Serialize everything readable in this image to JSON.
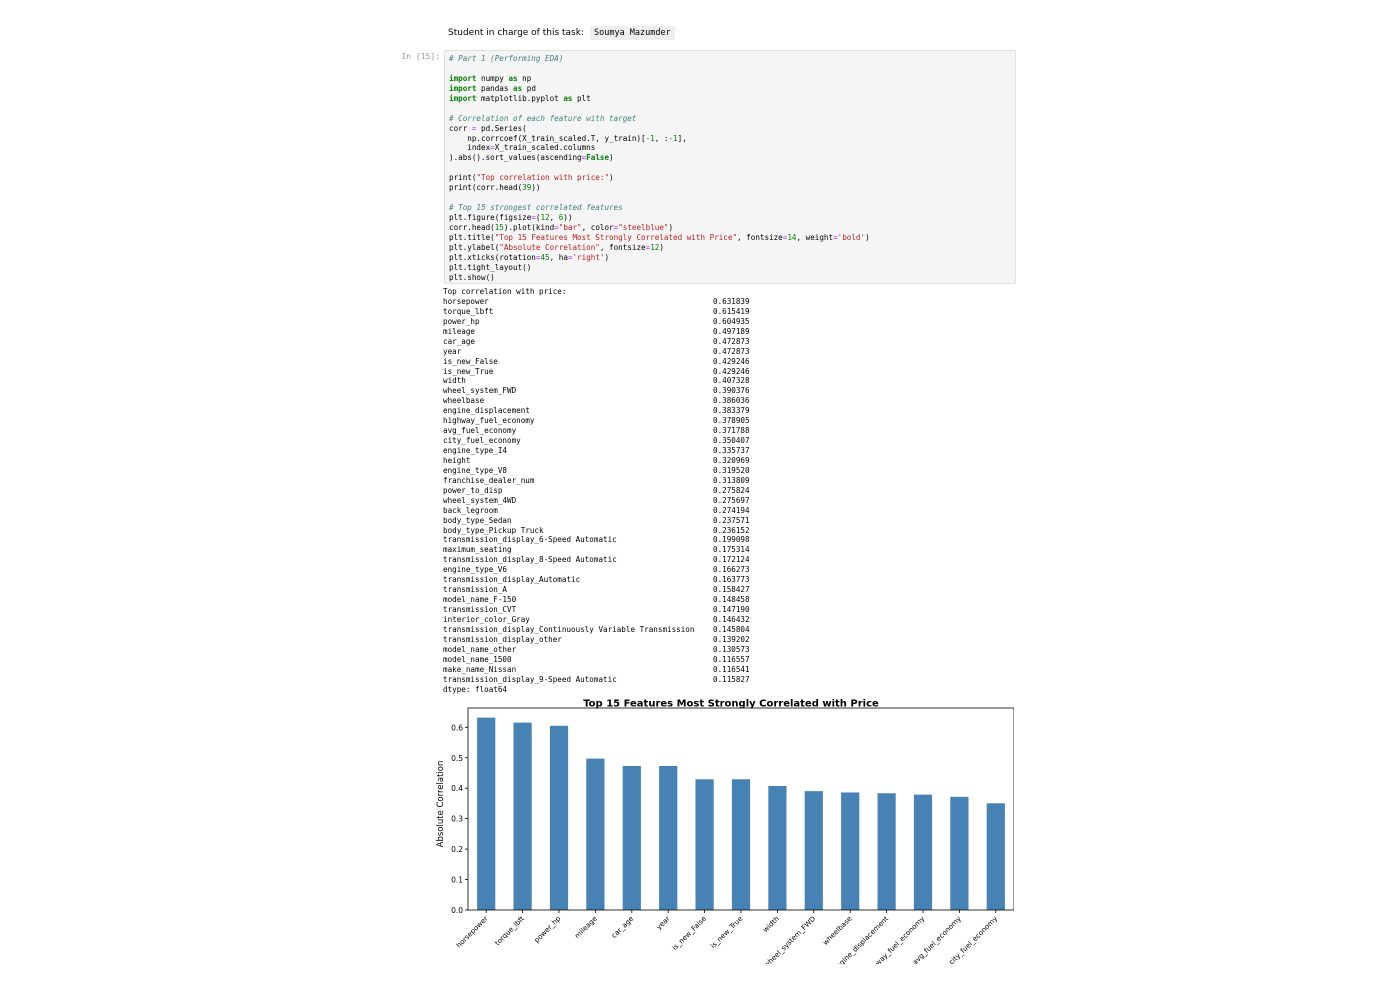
{
  "header": {
    "label": "Student in charge of this task:",
    "student": "Soumya Mazumder"
  },
  "cell": {
    "prompt": "In [15]:",
    "code_lines": [
      [
        {
          "t": "# Part 1 (Performing EDA)",
          "c": "c-cm"
        }
      ],
      [],
      [
        {
          "t": "import",
          "c": "c-kw"
        },
        {
          "t": " numpy "
        },
        {
          "t": "as",
          "c": "c-kw"
        },
        {
          "t": " np"
        }
      ],
      [
        {
          "t": "import",
          "c": "c-kw"
        },
        {
          "t": " pandas "
        },
        {
          "t": "as",
          "c": "c-kw"
        },
        {
          "t": " pd"
        }
      ],
      [
        {
          "t": "import",
          "c": "c-kw"
        },
        {
          "t": " matplotlib.pyplot "
        },
        {
          "t": "as",
          "c": "c-kw"
        },
        {
          "t": " plt"
        }
      ],
      [],
      [
        {
          "t": "# Correlation of each feature with target",
          "c": "c-cm"
        }
      ],
      [
        {
          "t": "corr "
        },
        {
          "t": "=",
          "c": "c-op"
        },
        {
          "t": " pd.Series("
        }
      ],
      [
        {
          "t": "    np.corrcoef(X_train_scaled.T, y_train)["
        },
        {
          "t": "-1",
          "c": "c-nm"
        },
        {
          "t": ", :"
        },
        {
          "t": "-1",
          "c": "c-nm"
        },
        {
          "t": "],"
        }
      ],
      [
        {
          "t": "    index"
        },
        {
          "t": "=",
          "c": "c-op"
        },
        {
          "t": "X_train_scaled.columns"
        }
      ],
      [
        {
          "t": ").abs().sort_values(ascending"
        },
        {
          "t": "=",
          "c": "c-op"
        },
        {
          "t": "False",
          "c": "c-kw"
        },
        {
          "t": ")"
        }
      ],
      [],
      [
        {
          "t": "print("
        },
        {
          "t": "\"Top correlation with price:\"",
          "c": "c-st"
        },
        {
          "t": ")"
        }
      ],
      [
        {
          "t": "print(corr.head("
        },
        {
          "t": "39",
          "c": "c-nm"
        },
        {
          "t": "))"
        }
      ],
      [],
      [
        {
          "t": "# Top 15 strongest correlated features",
          "c": "c-cm"
        }
      ],
      [
        {
          "t": "plt.figure(figsize"
        },
        {
          "t": "=",
          "c": "c-op"
        },
        {
          "t": "("
        },
        {
          "t": "12",
          "c": "c-nm"
        },
        {
          "t": ", "
        },
        {
          "t": "6",
          "c": "c-nm"
        },
        {
          "t": "))"
        }
      ],
      [
        {
          "t": "corr.head("
        },
        {
          "t": "15",
          "c": "c-nm"
        },
        {
          "t": ").plot(kind"
        },
        {
          "t": "=",
          "c": "c-op"
        },
        {
          "t": "\"bar\"",
          "c": "c-st"
        },
        {
          "t": ", color"
        },
        {
          "t": "=",
          "c": "c-op"
        },
        {
          "t": "\"steelblue\"",
          "c": "c-st"
        },
        {
          "t": ")"
        }
      ],
      [
        {
          "t": "plt.title("
        },
        {
          "t": "\"Top 15 Features Most Strongly Correlated with Price\"",
          "c": "c-st"
        },
        {
          "t": ", fontsize"
        },
        {
          "t": "=",
          "c": "c-op"
        },
        {
          "t": "14",
          "c": "c-nm"
        },
        {
          "t": ", weight"
        },
        {
          "t": "=",
          "c": "c-op"
        },
        {
          "t": "'bold'",
          "c": "c-st"
        },
        {
          "t": ")"
        }
      ],
      [
        {
          "t": "plt.ylabel("
        },
        {
          "t": "\"Absolute Correlation\"",
          "c": "c-st"
        },
        {
          "t": ", fontsize"
        },
        {
          "t": "=",
          "c": "c-op"
        },
        {
          "t": "12",
          "c": "c-nm"
        },
        {
          "t": ")"
        }
      ],
      [
        {
          "t": "plt.xticks(rotation"
        },
        {
          "t": "=",
          "c": "c-op"
        },
        {
          "t": "45",
          "c": "c-nm"
        },
        {
          "t": ", ha"
        },
        {
          "t": "=",
          "c": "c-op"
        },
        {
          "t": "'right'",
          "c": "c-st"
        },
        {
          "t": ")"
        }
      ],
      [
        {
          "t": "plt.tight_layout()"
        }
      ],
      [
        {
          "t": "plt.show()"
        }
      ]
    ]
  },
  "output": {
    "header": "Top correlation with price:",
    "rows": [
      [
        "horsepower",
        "0.631839"
      ],
      [
        "torque_lbft",
        "0.615419"
      ],
      [
        "power_hp",
        "0.604935"
      ],
      [
        "mileage",
        "0.497189"
      ],
      [
        "car_age",
        "0.472873"
      ],
      [
        "year",
        "0.472873"
      ],
      [
        "is_new_False",
        "0.429246"
      ],
      [
        "is_new_True",
        "0.429246"
      ],
      [
        "width",
        "0.407328"
      ],
      [
        "wheel_system_FWD",
        "0.390376"
      ],
      [
        "wheelbase",
        "0.386036"
      ],
      [
        "engine_displacement",
        "0.383379"
      ],
      [
        "highway_fuel_economy",
        "0.378905"
      ],
      [
        "avg_fuel_economy",
        "0.371788"
      ],
      [
        "city_fuel_economy",
        "0.350407"
      ],
      [
        "engine_type_I4",
        "0.335737"
      ],
      [
        "height",
        "0.320969"
      ],
      [
        "engine_type_V8",
        "0.319520"
      ],
      [
        "franchise_dealer_num",
        "0.313809"
      ],
      [
        "power_to_disp",
        "0.275824"
      ],
      [
        "wheel_system_4WD",
        "0.275697"
      ],
      [
        "back_legroom",
        "0.274194"
      ],
      [
        "body_type_Sedan",
        "0.237571"
      ],
      [
        "body_type_Pickup Truck",
        "0.236152"
      ],
      [
        "transmission_display_6-Speed Automatic",
        "0.199098"
      ],
      [
        "maximum_seating",
        "0.175314"
      ],
      [
        "transmission_display_8-Speed Automatic",
        "0.172124"
      ],
      [
        "engine_type_V6",
        "0.166273"
      ],
      [
        "transmission_display_Automatic",
        "0.163773"
      ],
      [
        "transmission_A",
        "0.158427"
      ],
      [
        "model_name_F-150",
        "0.148458"
      ],
      [
        "transmission_CVT",
        "0.147190"
      ],
      [
        "interior_color_Gray",
        "0.146432"
      ],
      [
        "transmission_display_Continuously Variable Transmission",
        "0.145804"
      ],
      [
        "transmission_display_other",
        "0.139202"
      ],
      [
        "model_name_other",
        "0.130573"
      ],
      [
        "model_name_1500",
        "0.116557"
      ],
      [
        "make_name_Nissan",
        "0.116541"
      ],
      [
        "transmission_display_9-Speed Automatic",
        "0.115827"
      ]
    ],
    "dtype": "dtype: float64"
  },
  "chart_data": {
    "type": "bar",
    "title": "Top 15 Features Most Strongly Correlated with Price",
    "xlabel": "",
    "ylabel": "Absolute Correlation",
    "color": "#4682b4",
    "ylim": [
      0,
      0.6634
    ],
    "yticks": [
      "0.0",
      "0.1",
      "0.2",
      "0.3",
      "0.4",
      "0.5",
      "0.6"
    ],
    "categories": [
      "horsepower",
      "torque_lbft",
      "power_hp",
      "mileage",
      "car_age",
      "year",
      "is_new_False",
      "is_new_True",
      "width",
      "wheel_system_FWD",
      "wheelbase",
      "engine_displacement",
      "highway_fuel_economy",
      "avg_fuel_economy",
      "city_fuel_economy"
    ],
    "values": [
      0.631839,
      0.615419,
      0.604935,
      0.497189,
      0.472873,
      0.472873,
      0.429246,
      0.429246,
      0.407328,
      0.390376,
      0.386036,
      0.383379,
      0.378905,
      0.371788,
      0.350407
    ]
  }
}
